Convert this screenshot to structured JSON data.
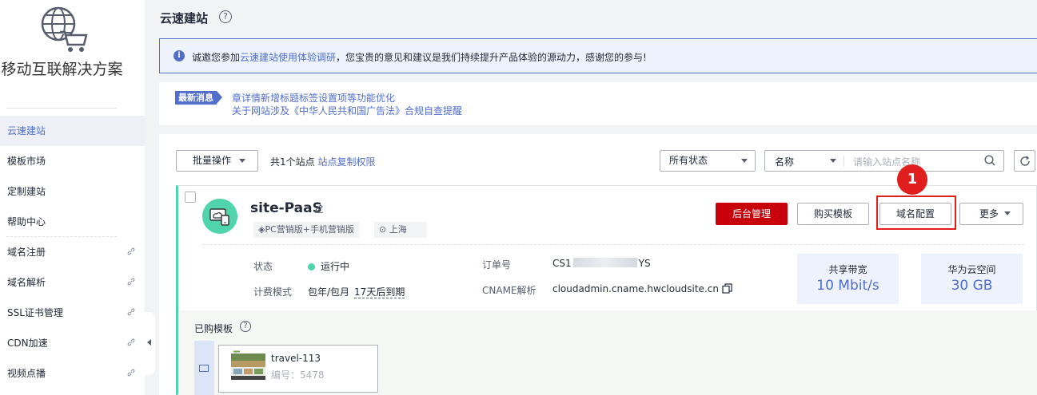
{
  "sidebar": {
    "title": "移动互联解决方案",
    "items": [
      {
        "label": "云速建站",
        "active": true,
        "external": false
      },
      {
        "label": "模板市场",
        "active": false,
        "external": false
      },
      {
        "label": "定制建站",
        "active": false,
        "external": false
      },
      {
        "label": "帮助中心",
        "active": false,
        "external": false
      },
      {
        "label": "域名注册",
        "active": false,
        "external": true
      },
      {
        "label": "域名解析",
        "active": false,
        "external": true
      },
      {
        "label": "SSL证书管理",
        "active": false,
        "external": true
      },
      {
        "label": "CDN加速",
        "active": false,
        "external": true
      },
      {
        "label": "视频点播",
        "active": false,
        "external": true
      }
    ]
  },
  "page": {
    "title": "云速建站",
    "help_icon": "?"
  },
  "notice": {
    "prefix": "诚邀您参加",
    "link": "云速建站使用体验调研",
    "suffix": "，您宝贵的意见和建议是我们持续提升产品体验的源动力，感谢您的参与!"
  },
  "news": {
    "badge": "最新消息",
    "line1": "章详情新增标题标签设置项等功能优化",
    "line2": "关于网站涉及《中华人民共和国广告法》合规自查提醒"
  },
  "toolbar": {
    "batch_label": "批量操作",
    "count_text": "共1个站点",
    "copy_link": "站点复制权限",
    "status_select": "所有状态",
    "field_select": "名称",
    "search_placeholder": "请输入站点名称"
  },
  "site": {
    "name": "site-PaaS",
    "tag_edition": "PC营销版+手机营销版",
    "tag_region": "上海",
    "buttons": {
      "admin": "后台管理",
      "buy_template": "购买模板",
      "domain_config": "域名配置",
      "more": "更多"
    },
    "step_marker": "1",
    "status_label": "状态",
    "status_value": "运行中",
    "billing_label": "计费模式",
    "billing_value": "包年/包月",
    "expire_value": "17天后到期",
    "order_label": "订单号",
    "order_prefix": "CS1",
    "order_suffix": "YS",
    "cname_label": "CNAME解析",
    "cname_value": "cloudadmin.cname.hwcloudsite.cn",
    "bandwidth_label": "共享带宽",
    "bandwidth_value": "10 Mbit/s",
    "storage_label": "华为云空间",
    "storage_value": "30 GB"
  },
  "templates": {
    "title": "已购模板",
    "items": [
      {
        "name": "travel-113",
        "number": "编号：5478"
      }
    ]
  },
  "colors": {
    "accent": "#526ecc",
    "danger": "#c7000b",
    "success": "#50d4ab",
    "highlight": "#e31d1a"
  }
}
